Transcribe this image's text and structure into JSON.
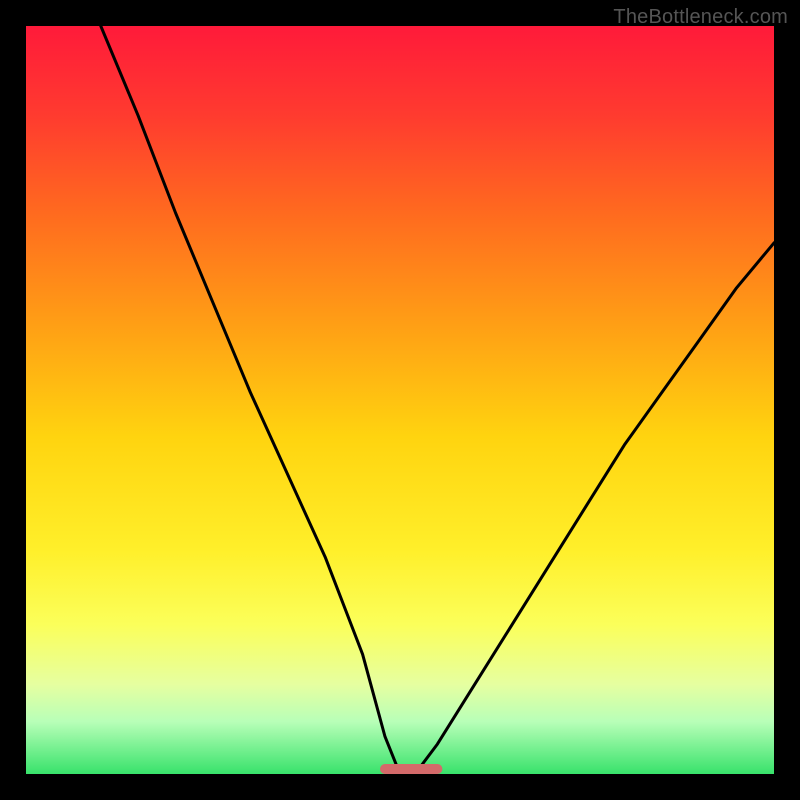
{
  "watermark": {
    "text": "TheBottleneck.com"
  },
  "chart_data": {
    "type": "line",
    "title": "",
    "xlabel": "",
    "ylabel": "",
    "xlim": [
      0,
      100
    ],
    "ylim": [
      0,
      100
    ],
    "grid": false,
    "legend": false,
    "annotations": [],
    "background_gradient": {
      "top_color": "#ff1a3a",
      "bottom_color": "#38e26b",
      "note": "vertical red-to-green gradient behind curve"
    },
    "series": [
      {
        "name": "bottleneck-curve",
        "note": "V-shaped curve; y≈0 near x≈50 (optimal balance), rises toward both ends",
        "x": [
          10,
          15,
          20,
          25,
          30,
          35,
          40,
          45,
          48,
          50,
          52,
          55,
          60,
          65,
          70,
          75,
          80,
          85,
          90,
          95,
          100
        ],
        "values": [
          100,
          88,
          75,
          63,
          51,
          40,
          29,
          16,
          5,
          0,
          0,
          4,
          12,
          20,
          28,
          36,
          44,
          51,
          58,
          65,
          71
        ]
      }
    ],
    "marker": {
      "name": "optimal-zone-marker",
      "color": "#d46a6a",
      "x_range": [
        48,
        55
      ],
      "y": 0
    }
  }
}
